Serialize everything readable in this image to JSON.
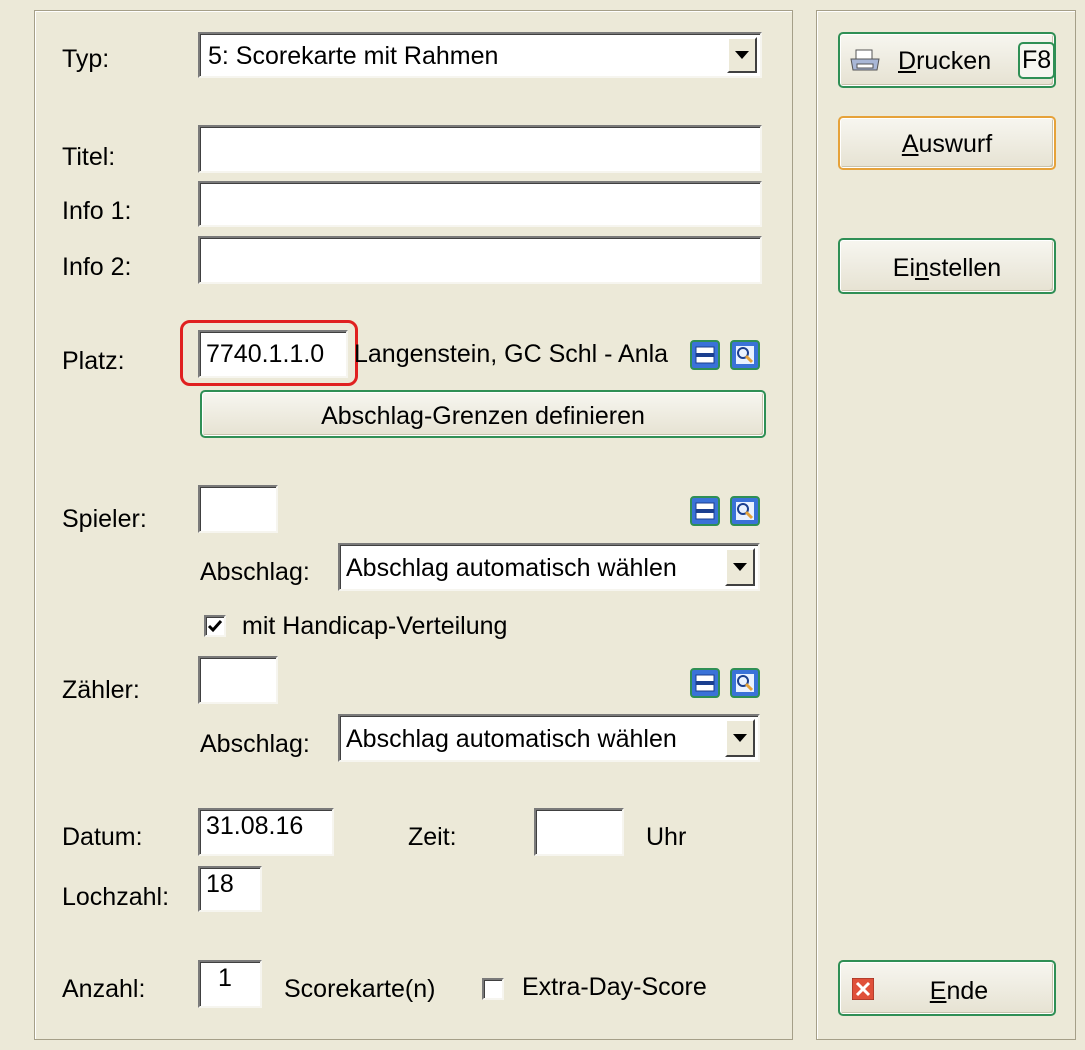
{
  "form": {
    "typ_label": "Typ:",
    "typ_value": "5: Scorekarte mit Rahmen",
    "titel_label": "Titel:",
    "titel_value": "",
    "info1_label": "Info 1:",
    "info1_value": "",
    "info2_label": "Info 2:",
    "info2_value": "",
    "platz_label": "Platz:",
    "platz_value": "7740.1.1.0",
    "platz_name": "Langenstein, GC Schl - Anla",
    "abschlag_grenzen_button": "Abschlag-Grenzen definieren",
    "spieler_label": "Spieler:",
    "spieler_value": "",
    "spieler_abschlag_label": "Abschlag:",
    "spieler_abschlag_value": "Abschlag automatisch wählen",
    "handicap_checkbox_label": "mit Handicap-Verteilung",
    "handicap_checked": true,
    "zaehler_label": "Zähler:",
    "zaehler_value": "",
    "zaehler_abschlag_label": "Abschlag:",
    "zaehler_abschlag_value": "Abschlag automatisch wählen",
    "datum_label": "Datum:",
    "datum_value": "31.08.16",
    "zeit_label": "Zeit:",
    "zeit_value": "",
    "uhr_label": "Uhr",
    "lochzahl_label": "Lochzahl:",
    "lochzahl_value": "18",
    "anzahl_label": "Anzahl:",
    "anzahl_value": "1",
    "scorekarten_label": "Scorekarte(n)",
    "extra_day_label": "Extra-Day-Score",
    "extra_day_checked": false
  },
  "buttons": {
    "drucken_u": "D",
    "drucken_rest": "rucken",
    "drucken_key": "F8",
    "auswurf_u": "A",
    "auswurf_rest": "uswurf",
    "einstellen_pre": "Ei",
    "einstellen_u": "n",
    "einstellen_rest": "stellen",
    "ende_u": "E",
    "ende_rest": "nde"
  },
  "icons": {
    "list": "list-icon",
    "search": "magnifier-icon",
    "printer": "printer-icon",
    "close": "red-x-icon"
  },
  "colors": {
    "window_bg": "#ece9d8",
    "button_border": "#2f8f55",
    "default_button_border": "#e6a23a",
    "highlight_box": "#e02020"
  }
}
